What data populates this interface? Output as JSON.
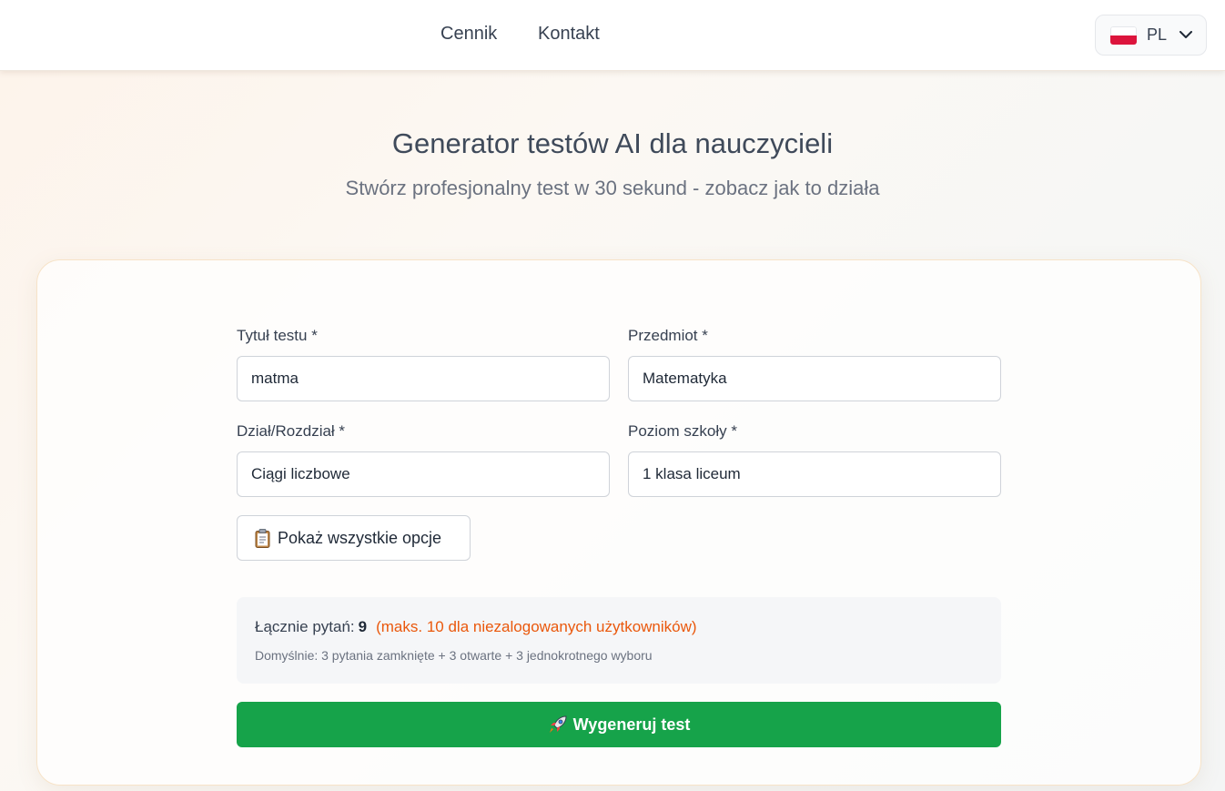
{
  "nav": {
    "links": [
      "Cennik",
      "Kontakt"
    ],
    "language": {
      "code": "PL",
      "flag_icon": "poland-flag-icon"
    }
  },
  "hero": {
    "title": "Generator testów AI dla nauczycieli",
    "subtitle": "Stwórz profesjonalny test w 30 sekund - zobacz jak to działa"
  },
  "form": {
    "fields": {
      "tytul": {
        "label": "Tytuł testu *",
        "value": "matma"
      },
      "przedmiot": {
        "label": "Przedmiot *",
        "value": "Matematyka"
      },
      "dzial": {
        "label": "Dział/Rozdział *",
        "value": "Ciągi liczbowe"
      },
      "poziom": {
        "label": "Poziom szkoły *",
        "value": "1 klasa liceum"
      }
    },
    "options_button": {
      "label": "Pokaż wszystkie opcje",
      "icon": "clipboard-icon"
    },
    "summary": {
      "total_label": "Łącznie pytań:",
      "total_count": "9",
      "limit_note": "(maks. 10 dla niezalogowanych użytkowników)",
      "default_note": "Domyślnie: 3 pytania zamknięte + 3 otwarte + 3 jednokrotnego wyboru"
    },
    "generate_button": {
      "label": "Wygeneruj test",
      "icon": "rocket-icon"
    }
  },
  "colors": {
    "primary_green": "#16a34a",
    "limit_orange": "#ea580c",
    "flag_red": "#dc143c"
  }
}
